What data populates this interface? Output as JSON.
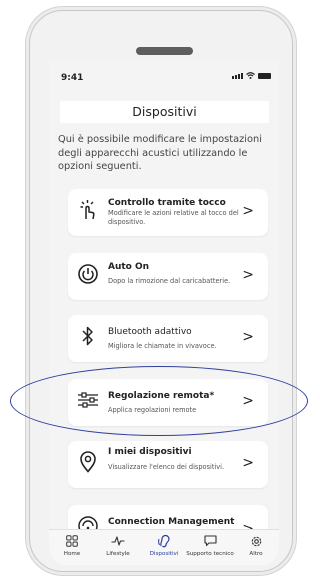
{
  "status_bar": {
    "time": "9:41"
  },
  "header": {
    "title": "Dispositivi"
  },
  "intro_text": "Qui è possibile modificare le impostazioni degli apparecchi acustici utilizzando le opzioni seguenti.",
  "menu_items": [
    {
      "title": "Controllo tramite tocco",
      "description": "Modificare le azioni relative al tocco del dispositivo.",
      "icon": "touch-icon"
    },
    {
      "title": "Auto On",
      "description": "Dopo la rimozione dal caricabatterie.",
      "icon": "power-icon"
    },
    {
      "title": "Bluetooth adattivo",
      "description": "Migliora le chiamate in vivavoce.",
      "icon": "bluetooth-icon"
    },
    {
      "title": "Regolazione remota*",
      "description": "Applica regolazioni remote",
      "icon": "sliders-icon"
    },
    {
      "title": "I miei dispositivi",
      "description": "Visualizzare l'elenco dei dispositivi.",
      "icon": "location-pin-icon"
    },
    {
      "title": "Connection Management",
      "description": "",
      "icon": "wifi-icon"
    }
  ],
  "tab_bar": [
    {
      "label": "Home",
      "icon": "grid-icon"
    },
    {
      "label": "Lifestyle",
      "icon": "pulse-icon"
    },
    {
      "label": "Dispositivi",
      "icon": "hearing-aid-icon",
      "active": true
    },
    {
      "label": "Supporto tecnico",
      "icon": "chat-icon"
    },
    {
      "label": "Altro",
      "icon": "gear-icon"
    }
  ],
  "colors": {
    "accent": "#2a3a9e",
    "highlight_ring": "#2f3fa0",
    "card": "#ffffff",
    "screen_bg": "#f4f4f4"
  }
}
